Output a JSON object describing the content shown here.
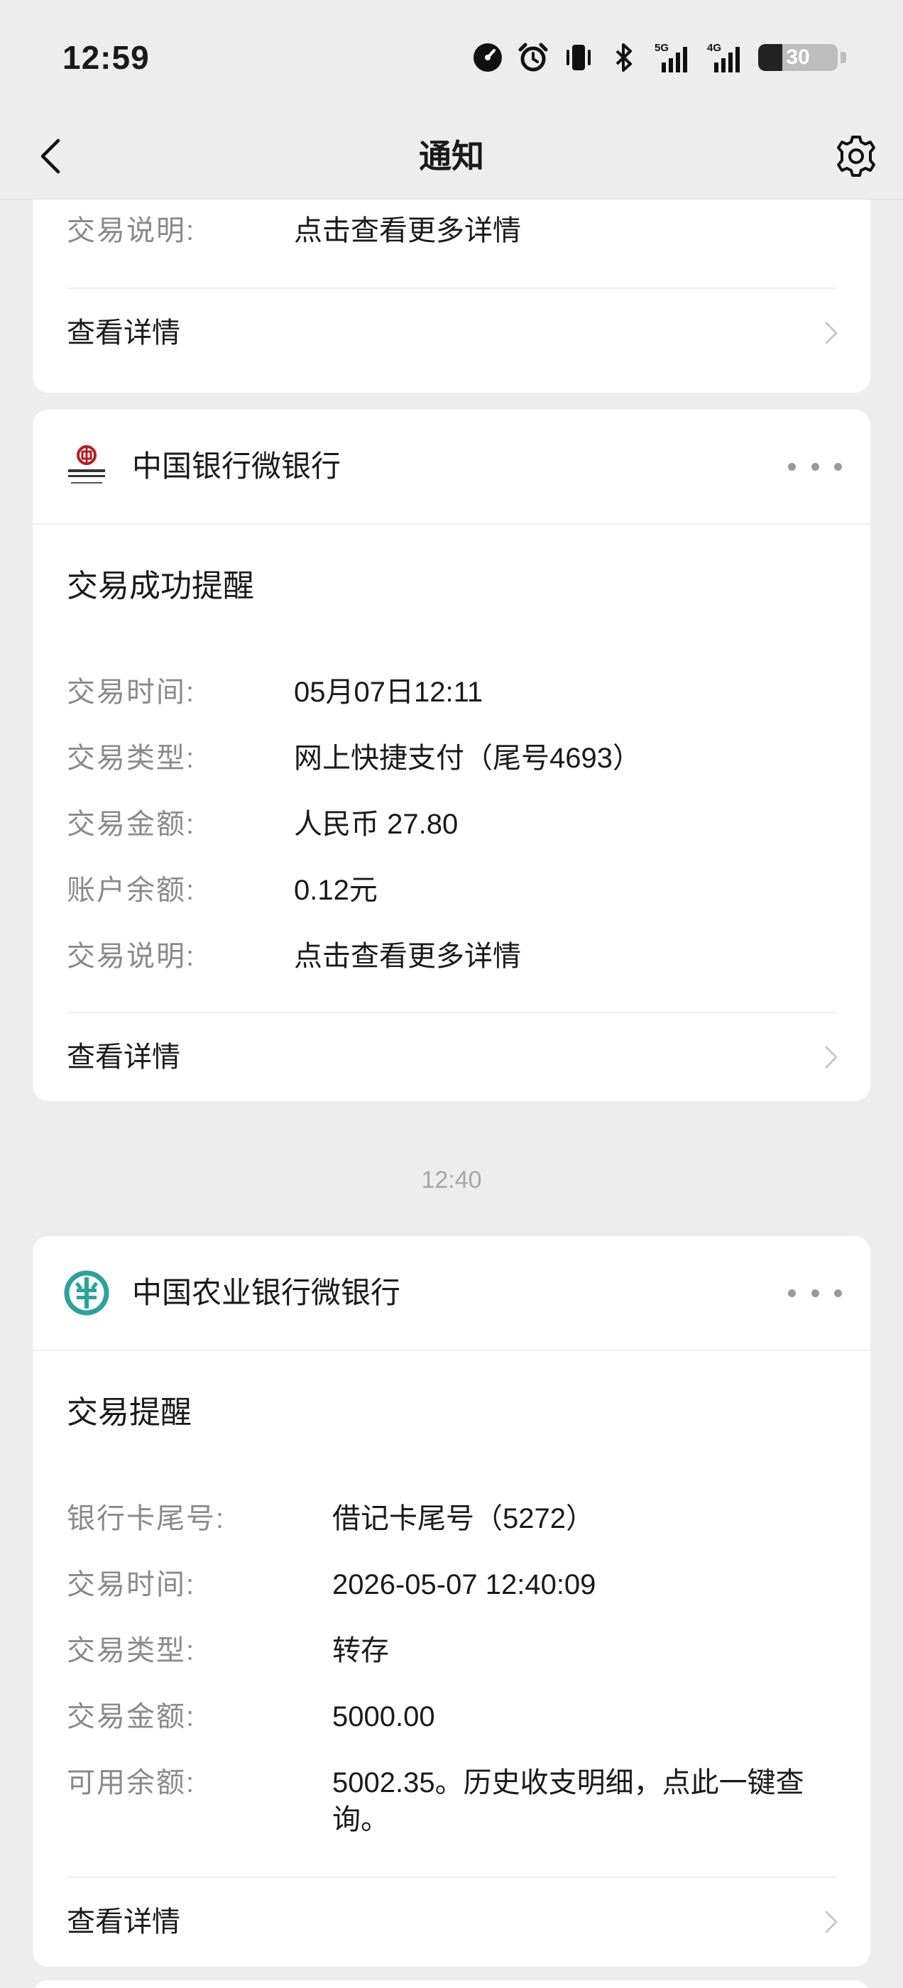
{
  "status_bar": {
    "time": "12:59",
    "battery": "30",
    "battery_level": 0.3
  },
  "nav": {
    "title": "通知"
  },
  "top_partial_card": {
    "row_label": "交易说明:",
    "row_value": "点击查看更多详情",
    "detail_label": "查看详情"
  },
  "boc_card": {
    "bank_name": "中国银行微银行",
    "title": "交易成功提醒",
    "rows": [
      {
        "label": "交易时间:",
        "value": "05月07日12:11"
      },
      {
        "label": "交易类型:",
        "value": "网上快捷支付（尾号4693）"
      },
      {
        "label": "交易金额:",
        "value": "人民币 27.80"
      },
      {
        "label": "账户余额:",
        "value": "0.12元"
      },
      {
        "label": "交易说明:",
        "value": "点击查看更多详情"
      }
    ],
    "detail_label": "查看详情"
  },
  "timestamp": "12:40",
  "abc_card": {
    "bank_name": "中国农业银行微银行",
    "title": "交易提醒",
    "rows": [
      {
        "label": "银行卡尾号:",
        "value": "借记卡尾号（5272）"
      },
      {
        "label": "交易时间:",
        "value": "2026-05-07 12:40:09"
      },
      {
        "label": "交易类型:",
        "value": "转存"
      },
      {
        "label": "交易金额:",
        "value": "5000.00"
      },
      {
        "label": "可用余额:",
        "value_line1": "5002.35。历史收支明细，点此一键查",
        "value_line2": "询。"
      }
    ],
    "detail_label": "查看详情"
  },
  "colors": {
    "background": "#ededed",
    "card": "#ffffff",
    "label_gray": "#8a8a8a",
    "boc_red": "#b81c22",
    "abc_teal": "#2aa39a"
  }
}
